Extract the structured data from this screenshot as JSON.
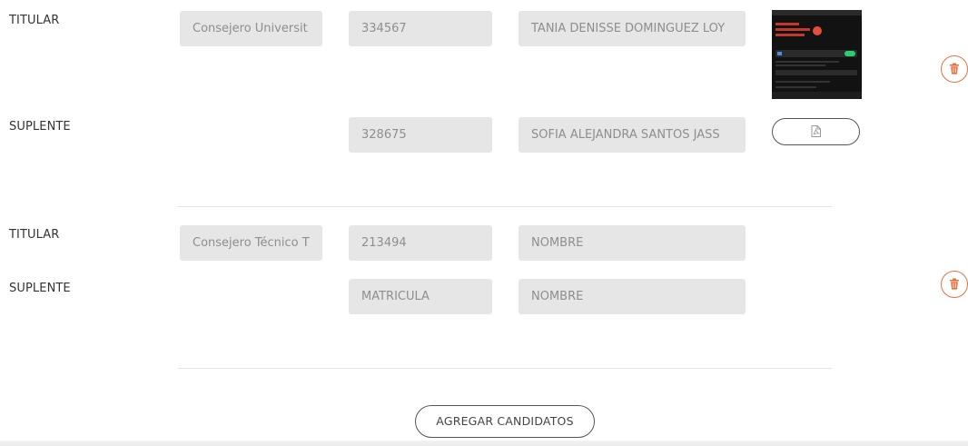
{
  "groups": [
    {
      "titular": {
        "role": "TITULAR",
        "cargo": "Consejero Universit",
        "matricula": "334567",
        "nombre": "TANIA DENISSE DOMINGUEZ LOY"
      },
      "suplente": {
        "role": "SUPLENTE",
        "matricula": "328675",
        "nombre": "SOFIA ALEJANDRA SANTOS JASS"
      }
    },
    {
      "titular": {
        "role": "TITULAR",
        "cargo": "Consejero Técnico T",
        "matricula": "213494",
        "nombre": "NOMBRE"
      },
      "suplente": {
        "role": "SUPLENTE",
        "matricula": "MATRICULA",
        "nombre": "NOMBRE"
      }
    }
  ],
  "actions": {
    "add_candidates": "AGREGAR CANDIDATOS"
  },
  "icons": {
    "delete": "trash-icon",
    "document": "pdf-file-icon"
  },
  "colors": {
    "accent": "#e8703f",
    "field_bg": "#e6e6e6"
  }
}
